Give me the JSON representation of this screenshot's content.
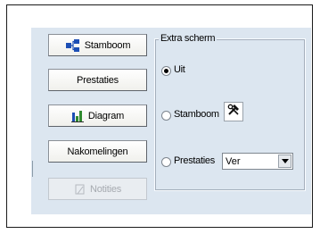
{
  "buttons": {
    "stamboom": {
      "label": "Stamboom",
      "icon": "family-tree-icon"
    },
    "prestaties": {
      "label": "Prestaties"
    },
    "diagram": {
      "label": "Diagram",
      "icon": "bar-chart-icon"
    },
    "nakomelingen": {
      "label": "Nakomelingen"
    },
    "notities": {
      "label": "Notities",
      "icon": "note-icon",
      "enabled": false
    }
  },
  "extra_scherm": {
    "title": "Extra scherm",
    "options": [
      {
        "label": "Uit",
        "selected": true
      },
      {
        "label": "Stamboom",
        "selected": false,
        "tool_icon": "hammer-wrench-icon"
      },
      {
        "label": "Prestaties",
        "selected": false
      }
    ],
    "prestaties_select": {
      "value": "Ver"
    }
  },
  "colors": {
    "panel": "#dce6f0",
    "accent_blue": "#1d4fb5",
    "chart_green": "#2f8a2f"
  }
}
